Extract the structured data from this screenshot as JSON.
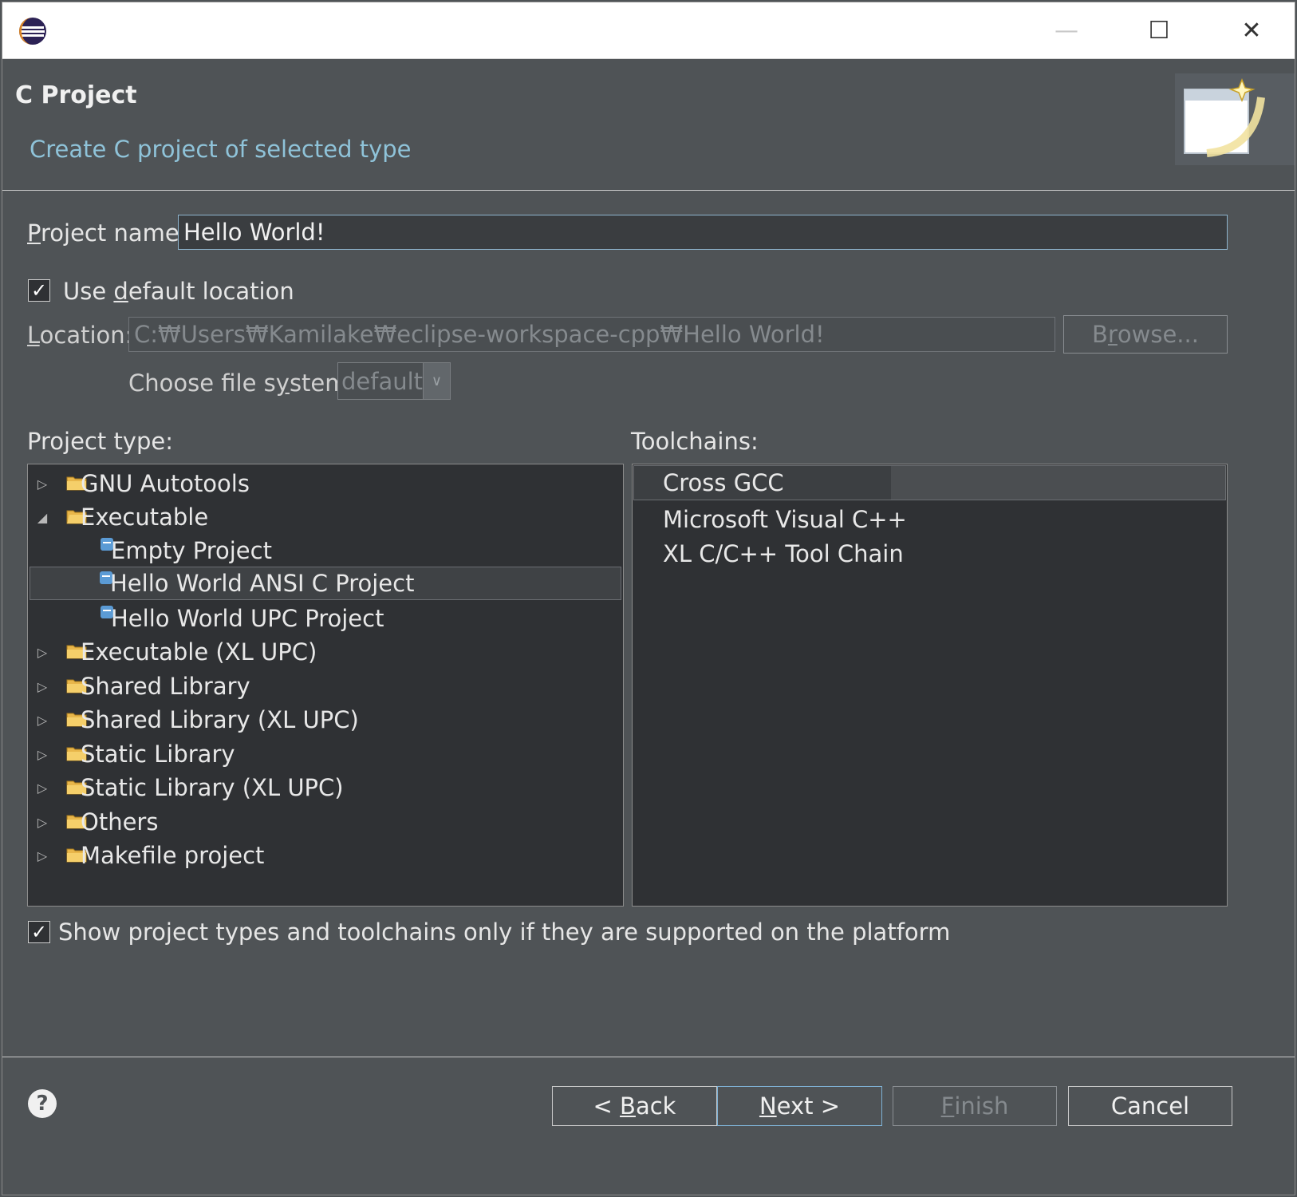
{
  "window": {
    "minimize_glyph": "—",
    "maximize_glyph": "☐",
    "close_glyph": "✕"
  },
  "header": {
    "title": "C Project",
    "description": "Create C project of selected type"
  },
  "form": {
    "project_name_label_prefix": "",
    "project_name_label_mnemonic": "P",
    "project_name_label_rest": "roject name:",
    "project_name_value": "Hello World!",
    "use_default_location_prefix": "Use ",
    "use_default_location_mnemonic": "d",
    "use_default_location_rest": "efault location",
    "use_default_location_checked": true,
    "location_label_mnemonic": "L",
    "location_label_rest": "ocation:",
    "location_value": "C:₩Users₩Kamilake₩eclipse-workspace-cpp₩Hello World!",
    "browse_prefix": "B",
    "browse_mnemonic": "r",
    "browse_rest": "owse...",
    "file_system_label_prefix": "Choose file s",
    "file_system_label_mnemonic": "y",
    "file_system_label_rest": "stem:",
    "file_system_value": "default"
  },
  "project_type": {
    "label": "Project type:",
    "items": [
      {
        "label": "GNU Autotools",
        "kind": "folder",
        "expanded": false
      },
      {
        "label": "Executable",
        "kind": "folder",
        "expanded": true
      },
      {
        "label": "Empty Project",
        "kind": "project"
      },
      {
        "label": "Hello World ANSI C Project",
        "kind": "project",
        "selected": true
      },
      {
        "label": "Hello World UPC Project",
        "kind": "project"
      },
      {
        "label": "Executable (XL UPC)",
        "kind": "folder",
        "expanded": false
      },
      {
        "label": "Shared Library",
        "kind": "folder",
        "expanded": false
      },
      {
        "label": "Shared Library (XL UPC)",
        "kind": "folder",
        "expanded": false
      },
      {
        "label": "Static Library",
        "kind": "folder",
        "expanded": false
      },
      {
        "label": "Static Library (XL UPC)",
        "kind": "folder",
        "expanded": false
      },
      {
        "label": "Others",
        "kind": "folder",
        "expanded": false
      },
      {
        "label": "Makefile project",
        "kind": "folder",
        "expanded": false
      }
    ]
  },
  "toolchains": {
    "label": "Toolchains:",
    "items": [
      "Cross GCC",
      "Microsoft Visual C++",
      "XL C/C++ Tool Chain"
    ],
    "selected": "Cross GCC"
  },
  "show_supported": {
    "label": "Show project types and toolchains only if they are supported on the platform",
    "checked": true
  },
  "footer": {
    "back_prefix": "< ",
    "back_mnemonic": "B",
    "back_rest": "ack",
    "next_mnemonic": "N",
    "next_rest": "ext >",
    "finish_mnemonic": "F",
    "finish_rest": "inish",
    "cancel": "Cancel"
  },
  "colors": {
    "background": "#4f5356",
    "panel": "#2f3134",
    "accent_text": "#8fc3d9",
    "folder": "#e8b64a",
    "project_icon": "#5b9bd5"
  }
}
